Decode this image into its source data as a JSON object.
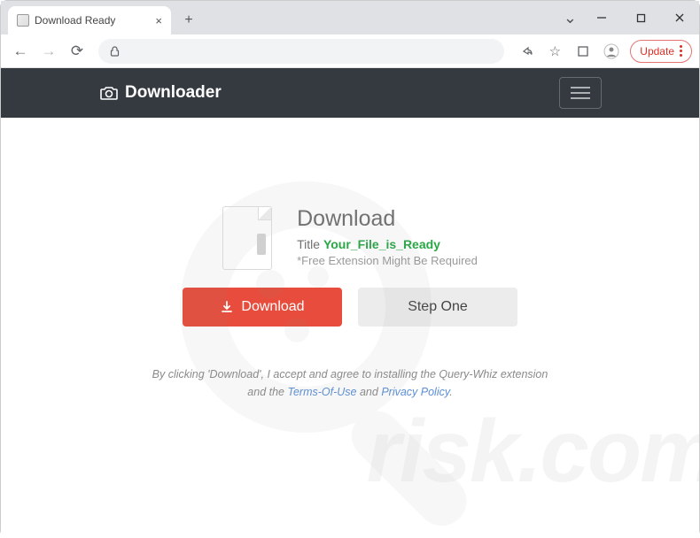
{
  "browser": {
    "tab_title": "Download Ready",
    "update_label": "Update"
  },
  "navbar": {
    "brand": "Downloader"
  },
  "main": {
    "heading": "Download",
    "title_prefix": "Title ",
    "filename": "Your_File_is_Ready",
    "note": "*Free Extension Might Be Required",
    "download_button": "Download",
    "step_button": "Step One"
  },
  "legal": {
    "line1_prefix": "By clicking 'Download', I accept and agree to installing the Query-Whiz extension",
    "line2_prefix": "and the ",
    "terms": "Terms-Of-Use",
    "mid": " and ",
    "privacy": "Privacy Policy",
    "suffix": "."
  },
  "watermark": {
    "text": "risk.com"
  }
}
